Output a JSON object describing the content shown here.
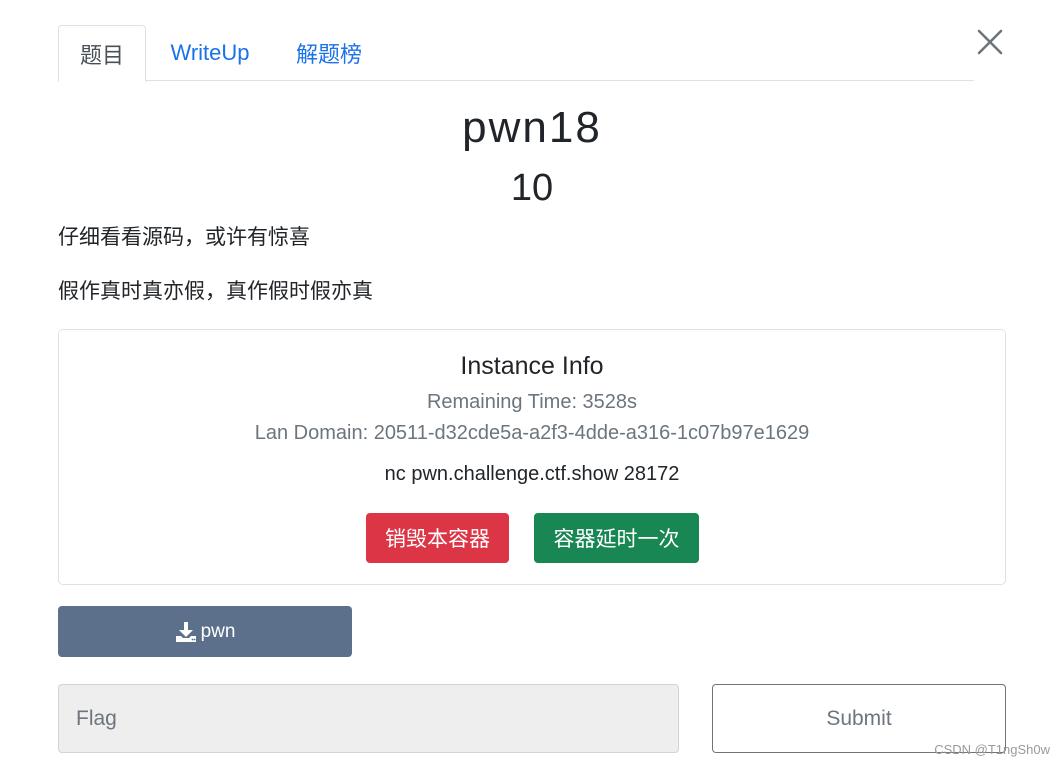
{
  "tabs": [
    {
      "label": "题目",
      "active": true
    },
    {
      "label": "WriteUp",
      "active": false
    },
    {
      "label": "解题榜",
      "active": false
    }
  ],
  "close_icon": "close-icon",
  "challenge": {
    "title": "pwn18",
    "score": "10",
    "description_lines": [
      "仔细看看源码，或许有惊喜",
      "假作真时真亦假，真作假时假亦真"
    ]
  },
  "instance": {
    "title": "Instance Info",
    "remaining_time": "Remaining Time: 3528s",
    "lan_domain": "Lan Domain: 20511-d32cde5a-a2f3-4dde-a316-1c07b97e1629",
    "nc_command": "nc pwn.challenge.ctf.show 28172",
    "destroy_label": "销毁本容器",
    "extend_label": "容器延时一次"
  },
  "download": {
    "label": "pwn",
    "icon": "download-icon"
  },
  "flag_form": {
    "placeholder": "Flag",
    "value": "",
    "submit_label": "Submit"
  },
  "watermark": "CSDN @T1ngSh0w",
  "colors": {
    "link": "#1a73e8",
    "danger": "#dc3545",
    "success": "#198754",
    "download": "#5c708c"
  }
}
